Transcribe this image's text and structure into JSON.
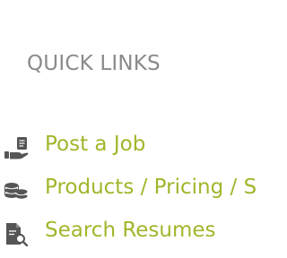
{
  "quick_links": {
    "title": "QUICK LINKS",
    "items": [
      {
        "label": "Post a Job",
        "icon": "hand-document-icon"
      },
      {
        "label": "Products / Pricing / Sp",
        "icon": "coin-stack-icon"
      },
      {
        "label": "Search Resumes",
        "icon": "document-search-icon"
      }
    ]
  },
  "colors": {
    "title": "#8a8a8a",
    "link": "#a3b52a",
    "icon": "#555555",
    "background": "#ffffff"
  }
}
